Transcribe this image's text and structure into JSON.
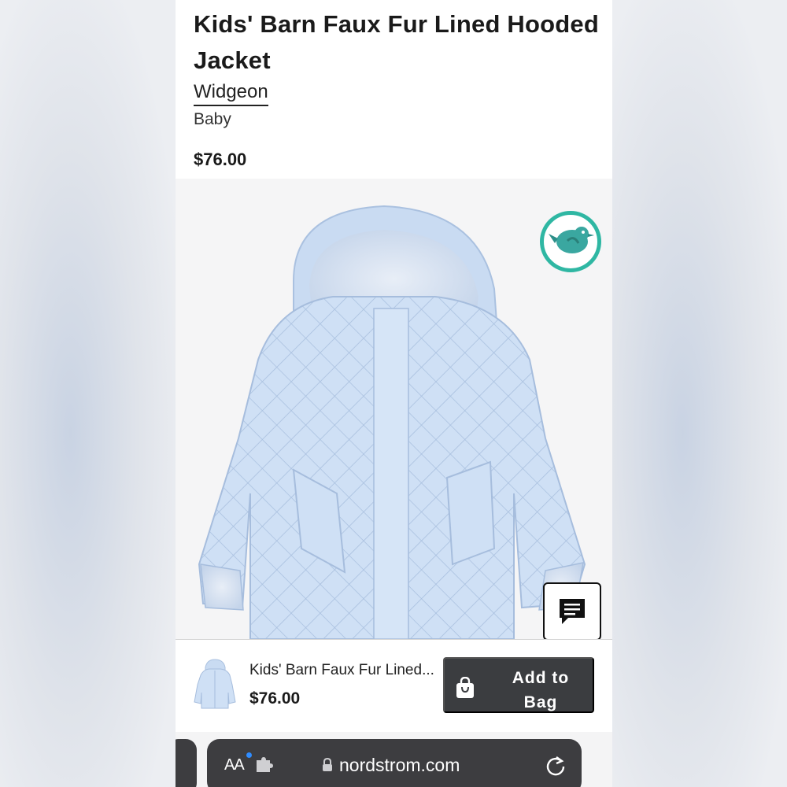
{
  "product": {
    "title": "Kids' Barn Faux Fur Lined Hooded Jacket",
    "brand": "Widgeon",
    "category": "Baby",
    "price": "$76.00"
  },
  "sticky_bar": {
    "name": "Kids' Barn Faux Fur Lined...",
    "price": "$76.00",
    "add_button_label": "Add to Bag"
  },
  "browser": {
    "text_size_label": "AA",
    "url": "nordstrom.com"
  },
  "icons": {
    "badge": "bird-badge-icon",
    "chat": "chat-icon",
    "bag": "shopping-bag-icon",
    "extension": "extension-icon",
    "lock": "lock-icon",
    "reload": "reload-icon"
  },
  "colors": {
    "jacket": "#cfe0f5",
    "badge_ring": "#2fb7a3",
    "button_bg": "#3b3d40",
    "url_bar_bg": "#3d3d40",
    "notification_dot": "#2f8cff"
  }
}
